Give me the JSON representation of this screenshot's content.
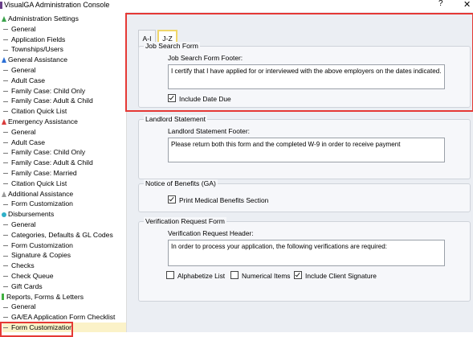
{
  "window": {
    "title": "VisualGA Administration Console",
    "help": "?",
    "close": "✕"
  },
  "sidebar": {
    "items": [
      {
        "label": "Administration Settings",
        "level": 0,
        "icon": "settings-icon"
      },
      {
        "label": "General",
        "level": 1
      },
      {
        "label": "Application Fields",
        "level": 1
      },
      {
        "label": "Townships/Users",
        "level": 1
      },
      {
        "label": "General Assistance",
        "level": 0,
        "icon": "general-icon"
      },
      {
        "label": "General",
        "level": 1
      },
      {
        "label": "Adult Case",
        "level": 1
      },
      {
        "label": "Family Case: Child Only",
        "level": 1
      },
      {
        "label": "Family Case: Adult & Child",
        "level": 1
      },
      {
        "label": "Citation Quick List",
        "level": 1
      },
      {
        "label": "Emergency Assistance",
        "level": 0,
        "icon": "emergency-icon"
      },
      {
        "label": "General",
        "level": 1
      },
      {
        "label": "Adult Case",
        "level": 1
      },
      {
        "label": "Family Case: Child Only",
        "level": 1
      },
      {
        "label": "Family Case: Adult & Child",
        "level": 1
      },
      {
        "label": "Family Case: Married",
        "level": 1
      },
      {
        "label": "Citation Quick List",
        "level": 1
      },
      {
        "label": "Additional Assistance",
        "level": 0,
        "icon": "additional-icon"
      },
      {
        "label": "Form Customization",
        "level": 1
      },
      {
        "label": "Disbursements",
        "level": 0,
        "icon": "disbursements-icon"
      },
      {
        "label": "General",
        "level": 1
      },
      {
        "label": "Categories, Defaults & GL Codes",
        "level": 1
      },
      {
        "label": "Form Customization",
        "level": 1
      },
      {
        "label": "Signature & Copies",
        "level": 1
      },
      {
        "label": "Checks",
        "level": 1
      },
      {
        "label": "Check Queue",
        "level": 1
      },
      {
        "label": "Gift Cards",
        "level": 1
      },
      {
        "label": "Reports, Forms & Letters",
        "level": 0,
        "icon": "reports-icon"
      },
      {
        "label": "General",
        "level": 1
      },
      {
        "label": "GA/EA Application Form Checklist",
        "level": 1
      },
      {
        "label": "Form Customization",
        "level": 1,
        "selected": true
      }
    ]
  },
  "tabs": [
    {
      "label": "A-I",
      "active": false
    },
    {
      "label": "J-Z",
      "active": true
    }
  ],
  "job_search": {
    "title": "Job Search Form",
    "footer_label": "Job Search Form Footer:",
    "footer_value": "I certify that I have applied for or interviewed with the above employers on the dates indicated.",
    "include_date_due": "Include Date Due"
  },
  "landlord": {
    "title": "Landlord Statement",
    "footer_label": "Landlord Statement Footer:",
    "footer_value": "Please return both this form and the completed W-9 in order to receive payment"
  },
  "notice": {
    "title": "Notice of Benefits (GA)",
    "print_medical": "Print Medical Benefits Section"
  },
  "verification": {
    "title": "Verification Request Form",
    "header_label": "Verification Request Header:",
    "header_value": "In order to process your application, the following verifications are required:",
    "alphabetize": "Alphabetize List",
    "numerical": "Numerical Items",
    "include_signature": "Include Client Signature"
  },
  "colors": {
    "highlight": "#e53935",
    "selected_item": "#fbf2c8",
    "active_tab_border": "#f0d66a"
  }
}
